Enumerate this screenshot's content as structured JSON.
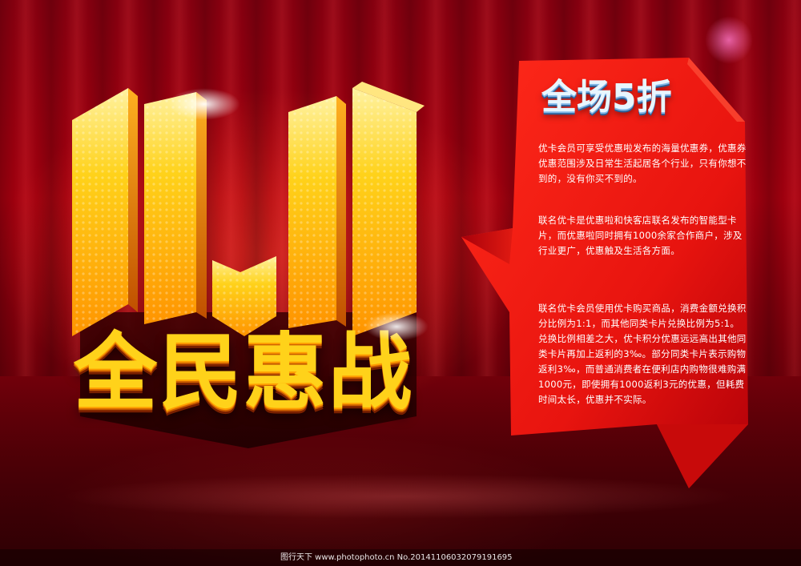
{
  "poster": {
    "headline": "全民惠战",
    "logo_text": "11.11",
    "colors": {
      "background": "#a5000f",
      "logo_gold": "#ffd21a",
      "logo_orange": "#ff9c00",
      "panel_red": "#e8140f",
      "title_blue": "#2c5e96"
    }
  },
  "panel": {
    "title": "全场5折",
    "paragraphs": [
      "优卡会员可享受优惠啦发布的海量优惠券，优惠券优惠范围涉及日常生活起居各个行业，只有你想不到的，没有你买不到的。",
      "联名优卡是优惠啦和快客店联名发布的智能型卡片，而优惠啦同时拥有1000余家合作商户，涉及行业更广，优惠触及生活各方面。",
      "联名优卡会员使用优卡购买商品，消费金额兑换积分比例为1:1，而其他同类卡片兑换比例为5:1。兑换比例相差之大，优卡积分优惠远远高出其他同类卡片再加上返利的3‰。部分同类卡片表示购物返利3‰，而普通消费者在便利店内购物很难购满1000元，即使拥有1000返利3元的优惠，但耗费时间太长，优惠并不实际。"
    ]
  },
  "footer": {
    "watermark": "图行天下 www.photophoto.cn  No.20141106032079191695"
  }
}
